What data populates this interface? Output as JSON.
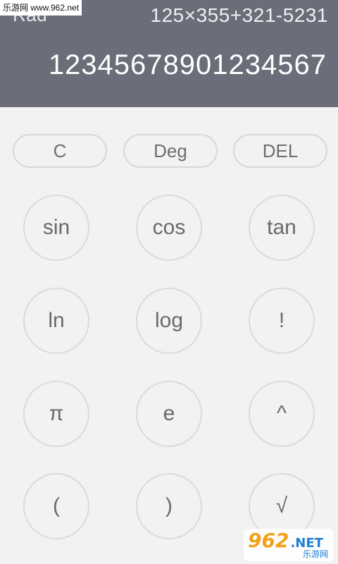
{
  "watermark": {
    "site_text": "乐游网 www.962.net",
    "logo_number": "962",
    "logo_suffix": ".NET",
    "logo_subtitle": "乐游网"
  },
  "display": {
    "angle_mode": "Rad",
    "expression": "125×355+321-5231",
    "result": "12345678901234567"
  },
  "controls": {
    "clear_label": "C",
    "deg_label": "Deg",
    "delete_label": "DEL"
  },
  "keys": {
    "sin": "sin",
    "cos": "cos",
    "tan": "tan",
    "ln": "ln",
    "log": "log",
    "factorial": "!",
    "pi": "π",
    "e": "e",
    "power": "^",
    "lparen": "(",
    "rparen": ")",
    "sqrt": "√"
  },
  "colors": {
    "display_bg": "#6b6d78",
    "keypad_bg": "#f2f2f2",
    "button_border": "#dadada",
    "button_text": "#6a6a6a"
  }
}
